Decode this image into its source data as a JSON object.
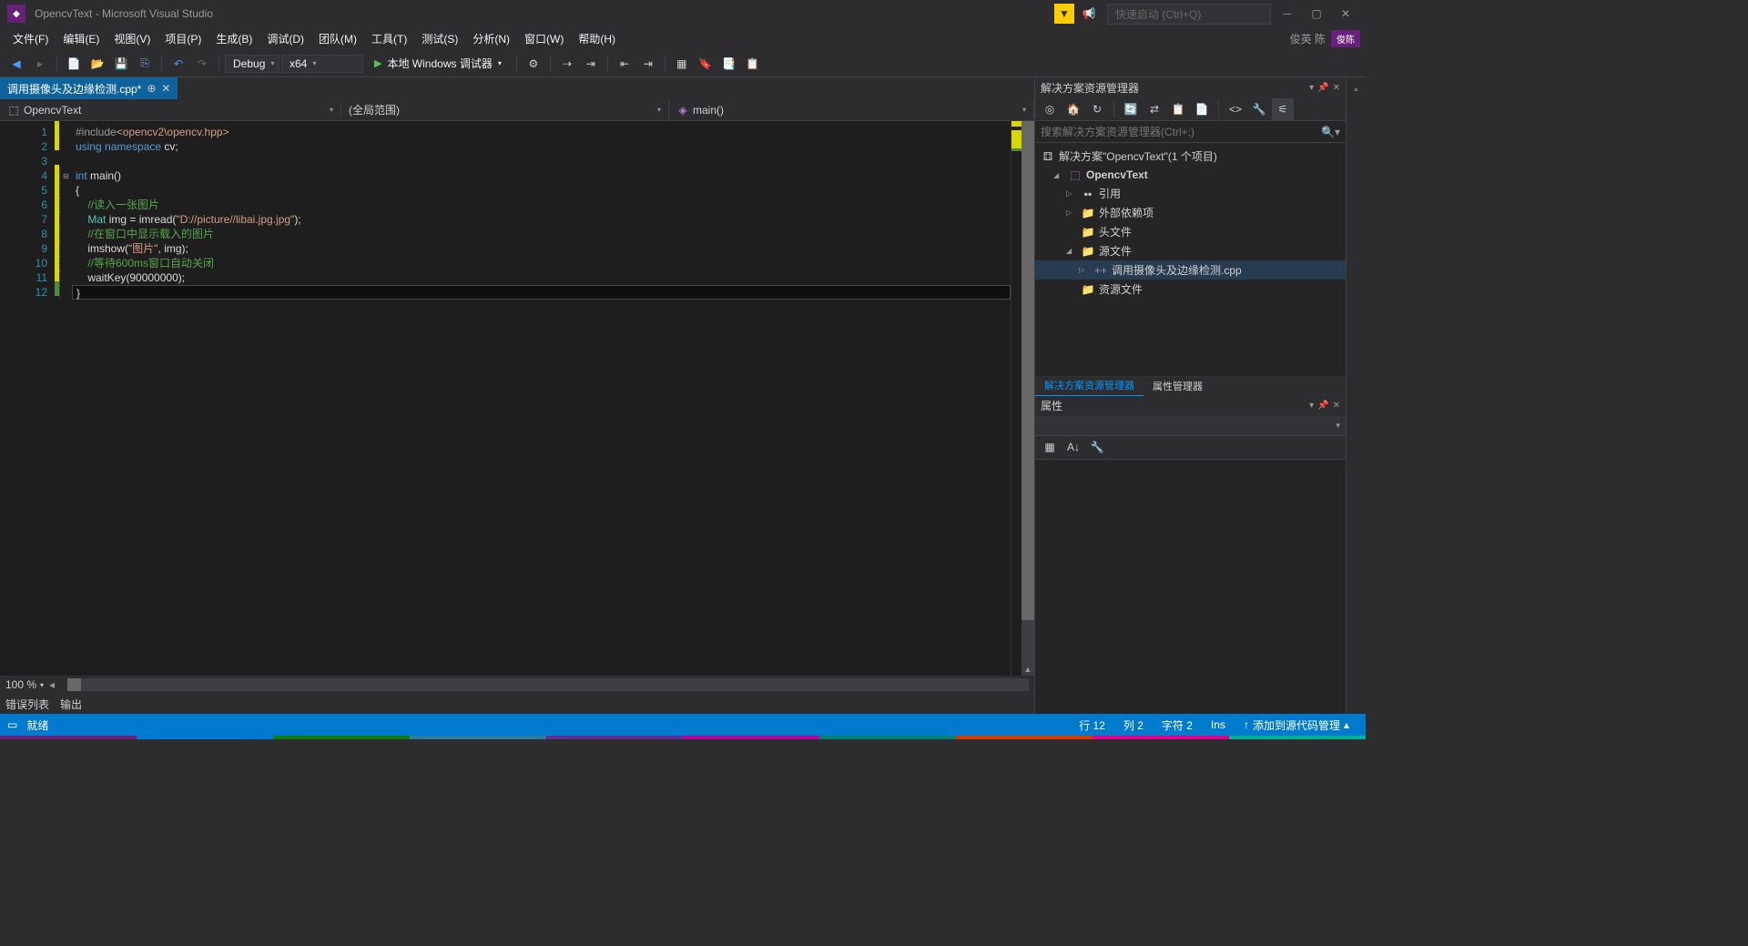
{
  "title": {
    "project": "OpencvText",
    "suffix": "Microsoft Visual Studio"
  },
  "quickLaunch": {
    "placeholder": "快速启动 (Ctrl+Q)"
  },
  "user": {
    "name": "俊英 陈",
    "badge": "俊陈"
  },
  "menu": {
    "file": "文件(F)",
    "edit": "编辑(E)",
    "view": "视图(V)",
    "project": "项目(P)",
    "build": "生成(B)",
    "debug": "调试(D)",
    "team": "团队(M)",
    "tools": "工具(T)",
    "test": "测试(S)",
    "analyze": "分析(N)",
    "window": "窗口(W)",
    "help": "帮助(H)"
  },
  "toolbar": {
    "config": "Debug",
    "platform": "x64",
    "debugger": "本地 Windows 调试器"
  },
  "tab": {
    "filename": "调用摄像头及边缘检测.cpp*"
  },
  "nav": {
    "project": "OpencvText",
    "scope": "(全局范围)",
    "member": "main()"
  },
  "code": {
    "lines": [
      {
        "n": 1,
        "mod": "modified"
      },
      {
        "n": 2,
        "mod": "modified"
      },
      {
        "n": 3,
        "mod": ""
      },
      {
        "n": 4,
        "mod": "modified"
      },
      {
        "n": 5,
        "mod": "modified"
      },
      {
        "n": 6,
        "mod": "modified"
      },
      {
        "n": 7,
        "mod": "modified"
      },
      {
        "n": 8,
        "mod": "modified"
      },
      {
        "n": 9,
        "mod": "modified"
      },
      {
        "n": 10,
        "mod": "modified"
      },
      {
        "n": 11,
        "mod": "modified"
      },
      {
        "n": 12,
        "mod": "modified-green"
      }
    ],
    "l1_inc": "#include",
    "l1_path": "<opencv2\\opencv.hpp>",
    "l2_using": "using",
    "l2_ns": "namespace",
    "l2_cv": "cv",
    "l4_int": "int",
    "l4_main": " main()",
    "l5": "{",
    "l6_cmt": "//读入一张图片",
    "l7_mat": "Mat",
    "l7_rest": " img = imread(",
    "l7_str": "\"D://picture//libai.jpg.jpg\"",
    "l7_end": ");",
    "l8_cmt": "//在窗口中显示载入的图片",
    "l9_call": "imshow(",
    "l9_str": "\"图片\"",
    "l9_end": ", img);",
    "l10_cmt": "//等待600ms窗口自动关闭",
    "l11": "waitKey(90000000);",
    "l12": "}"
  },
  "zoom": "100 %",
  "bottomTabs": {
    "errors": "错误列表",
    "output": "输出"
  },
  "solutionExplorer": {
    "title": "解决方案资源管理器",
    "searchPlaceholder": "搜索解决方案资源管理器(Ctrl+;)",
    "root": "解决方案\"OpencvText\"(1 个项目)",
    "project": "OpencvText",
    "refs": "引用",
    "externalDeps": "外部依赖项",
    "headers": "头文件",
    "sources": "源文件",
    "sourceFile": "调用摄像头及边缘检测.cpp",
    "resources": "资源文件",
    "tab1": "解决方案资源管理器",
    "tab2": "属性管理器"
  },
  "properties": {
    "title": "属性"
  },
  "status": {
    "ready": "就绪",
    "line": "行 12",
    "col": "列 2",
    "char": "字符 2",
    "ins": "Ins",
    "scm": "添加到源代码管理"
  }
}
